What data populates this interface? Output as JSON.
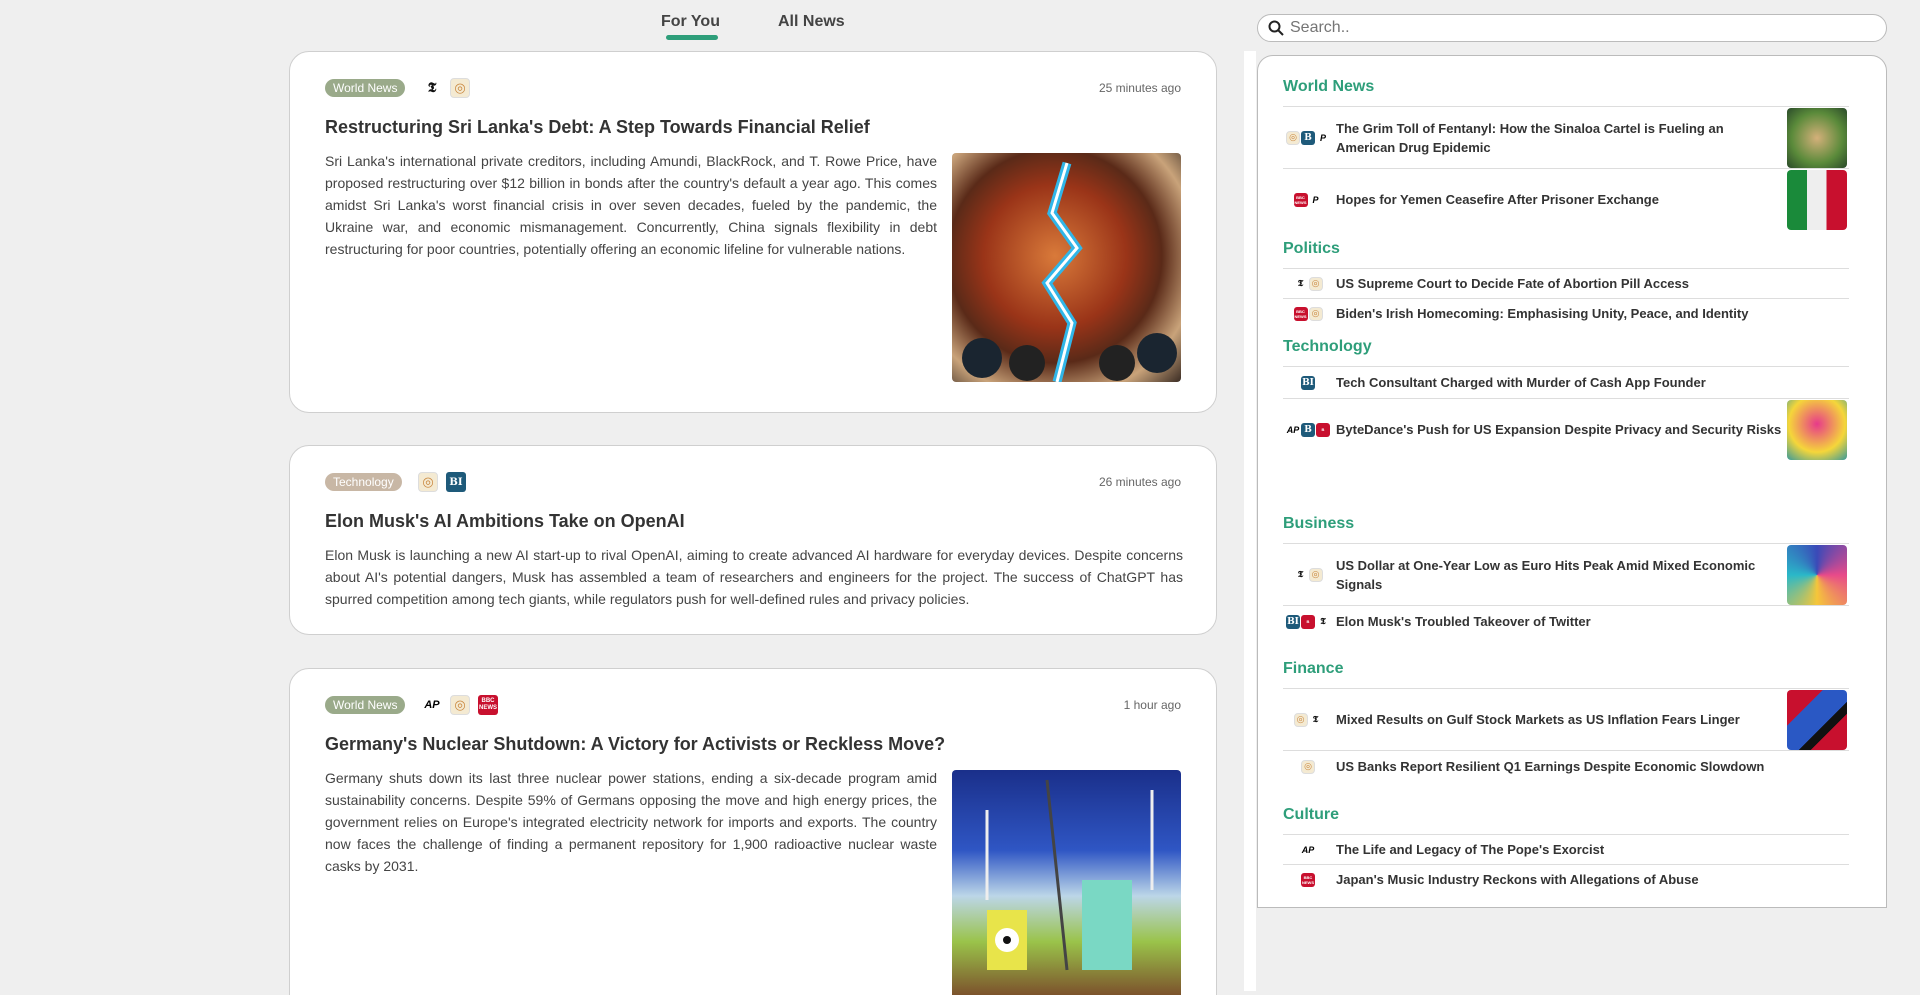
{
  "tabs": {
    "for_you": "For You",
    "all_news": "All News"
  },
  "search": {
    "placeholder": "Search.."
  },
  "feed": [
    {
      "category": "World News",
      "sources": [
        "nyt",
        "orb"
      ],
      "timestamp": "25 minutes ago",
      "title": "Restructuring Sri Lanka's Debt: A Step Towards Financial Relief",
      "summary": "Sri Lanka's international private creditors, including Amundi, BlackRock, and T. Rowe Price, have proposed restructuring over $12 billion in bonds after the country's default a year ago. This comes amidst Sri Lanka's worst financial crisis in over seven decades, fueled by the pandemic, the Ukraine war, and economic mismanagement. Concurrently, China signals flexibility in debt restructuring for poor countries, potentially offering an economic lifeline for vulnerable nations."
    },
    {
      "category": "Technology",
      "sources": [
        "orb",
        "bi"
      ],
      "timestamp": "26 minutes ago",
      "title": "Elon Musk's AI Ambitions Take on OpenAI",
      "summary": "Elon Musk is launching a new AI start-up to rival OpenAI, aiming to create advanced AI hardware for everyday devices. Despite concerns about AI's potential dangers, Musk has assembled a team of researchers and engineers for the project. The success of ChatGPT has spurred competition among tech giants, while regulators push for well-defined rules and privacy policies."
    },
    {
      "category": "World News",
      "sources": [
        "ap",
        "orb",
        "bbc"
      ],
      "timestamp": "1 hour ago",
      "title": "Germany's Nuclear Shutdown: A Victory for Activists or Reckless Move?",
      "summary": "Germany shuts down its last three nuclear power stations, ending a six-decade program amid sustainability concerns. Despite 59% of Germans opposing the move and high energy prices, the government relies on Europe's integrated electricity network for imports and exports. The country now faces the challenge of finding a permanent repository for 1,900 radioactive nuclear waste casks by 2031."
    }
  ],
  "sidebar": {
    "sections": [
      {
        "title": "World News",
        "items": [
          {
            "title": "The Grim Toll of Fentanyl: How the Sinaloa Cartel is Fueling an American Drug Epidemic"
          },
          {
            "title": "Hopes for Yemen Ceasefire After Prisoner Exchange"
          }
        ]
      },
      {
        "title": "Politics",
        "items": [
          {
            "title": "US Supreme Court to Decide Fate of Abortion Pill Access"
          },
          {
            "title": "Biden's Irish Homecoming: Emphasising Unity, Peace, and Identity"
          }
        ]
      },
      {
        "title": "Technology",
        "items": [
          {
            "title": "Tech Consultant Charged with Murder of Cash App Founder"
          },
          {
            "title": "ByteDance's Push for US Expansion Despite Privacy and Security Risks"
          }
        ]
      },
      {
        "title": "Business",
        "items": [
          {
            "title": "US Dollar at One-Year Low as Euro Hits Peak Amid Mixed Economic Signals"
          },
          {
            "title": "Elon Musk's Troubled Takeover of Twitter"
          }
        ]
      },
      {
        "title": "Finance",
        "items": [
          {
            "title": "Mixed Results on Gulf Stock Markets as US Inflation Fears Linger"
          },
          {
            "title": "US Banks Report Resilient Q1 Earnings Despite Economic Slowdown"
          }
        ]
      },
      {
        "title": "Culture",
        "items": [
          {
            "title": "The Life and Legacy of The Pope's Exorcist"
          },
          {
            "title": "Japan's Music Industry Reckons with Allegations of Abuse"
          }
        ]
      }
    ]
  },
  "colors": {
    "accent": "#2e9e7a",
    "badge_world": "#9aaa8a",
    "badge_tech": "#c8b7a5"
  }
}
